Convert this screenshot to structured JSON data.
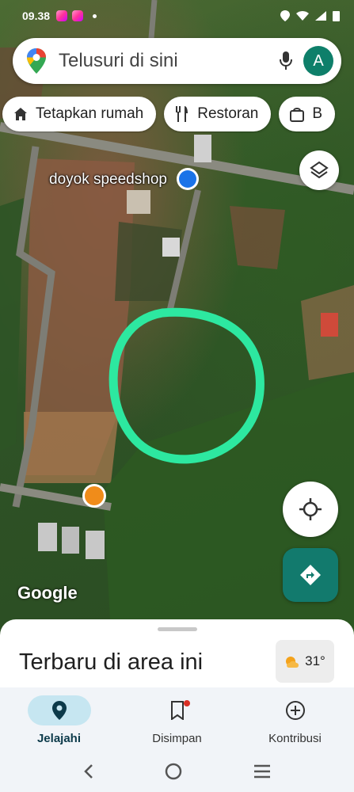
{
  "status_bar": {
    "time": "09.38"
  },
  "search": {
    "placeholder": "Telusuri di sini",
    "avatar_letter": "A"
  },
  "chips": [
    {
      "icon": "home-icon",
      "label": "Tetapkan rumah"
    },
    {
      "icon": "restaurant-icon",
      "label": "Restoran"
    },
    {
      "icon": "shopping-bag-icon",
      "label": "B"
    }
  ],
  "map": {
    "place_label": "doyok speedshop",
    "attribution": "Google",
    "highlight_color": "#2de8a0"
  },
  "sheet": {
    "title": "Terbaru di area ini",
    "temperature": "31°"
  },
  "nav": [
    {
      "icon": "explore-pin-icon",
      "label": "Jelajahi",
      "active": true
    },
    {
      "icon": "bookmark-icon",
      "label": "Disimpan",
      "active": false
    },
    {
      "icon": "add-circle-icon",
      "label": "Kontribusi",
      "active": false
    }
  ],
  "colors": {
    "accent": "#127a6d",
    "avatar": "#0e7f6a",
    "nav_active": "#c6e6f1"
  }
}
